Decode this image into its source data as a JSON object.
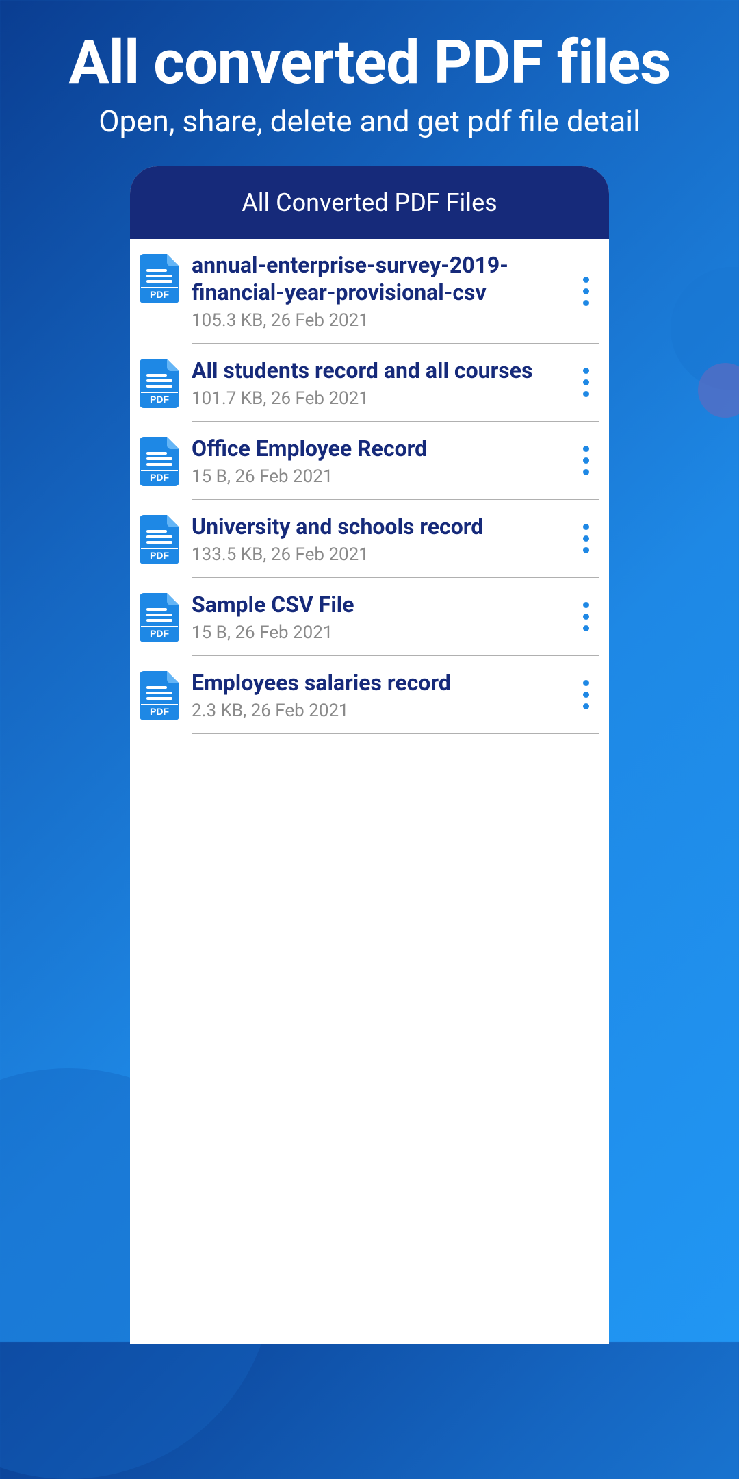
{
  "page": {
    "title": "All converted PDF files",
    "subtitle": "Open, share, delete and get pdf file detail"
  },
  "card": {
    "header": "All Converted PDF Files"
  },
  "files": [
    {
      "title": "annual-enterprise-survey-2019-financial-year-provisional-csv",
      "meta": "105.3 KB, 26 Feb 2021"
    },
    {
      "title": "All students record and all courses",
      "meta": "101.7 KB, 26 Feb 2021"
    },
    {
      "title": "Office Employee Record",
      "meta": "15 B, 26 Feb 2021"
    },
    {
      "title": "University and schools record",
      "meta": "133.5 KB, 26 Feb 2021"
    },
    {
      "title": "Sample CSV File",
      "meta": "15 B, 26 Feb 2021"
    },
    {
      "title": "Employees salaries record",
      "meta": "2.3 KB, 26 Feb 2021"
    }
  ]
}
